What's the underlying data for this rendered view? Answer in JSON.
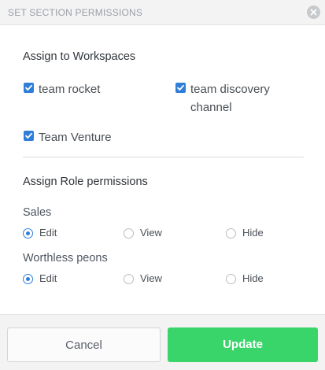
{
  "dialog": {
    "title": "SET SECTION PERMISSIONS",
    "close_icon": "close-icon"
  },
  "workspaces": {
    "heading": "Assign to Workspaces",
    "items": [
      {
        "label": "team rocket",
        "checked": true
      },
      {
        "label": "team discovery",
        "label_line2": "channel",
        "checked": true
      },
      {
        "label": "Team Venture",
        "checked": true
      }
    ]
  },
  "roles": {
    "heading": "Assign Role permissions",
    "option_labels": [
      "Edit",
      "View",
      "Hide"
    ],
    "items": [
      {
        "name": "Sales",
        "selected": "Edit"
      },
      {
        "name": "Worthless peons",
        "selected": "Edit"
      }
    ]
  },
  "footer": {
    "cancel_label": "Cancel",
    "update_label": "Update"
  },
  "colors": {
    "accent": "#2f7fd8",
    "update_button": "#39d46a"
  }
}
